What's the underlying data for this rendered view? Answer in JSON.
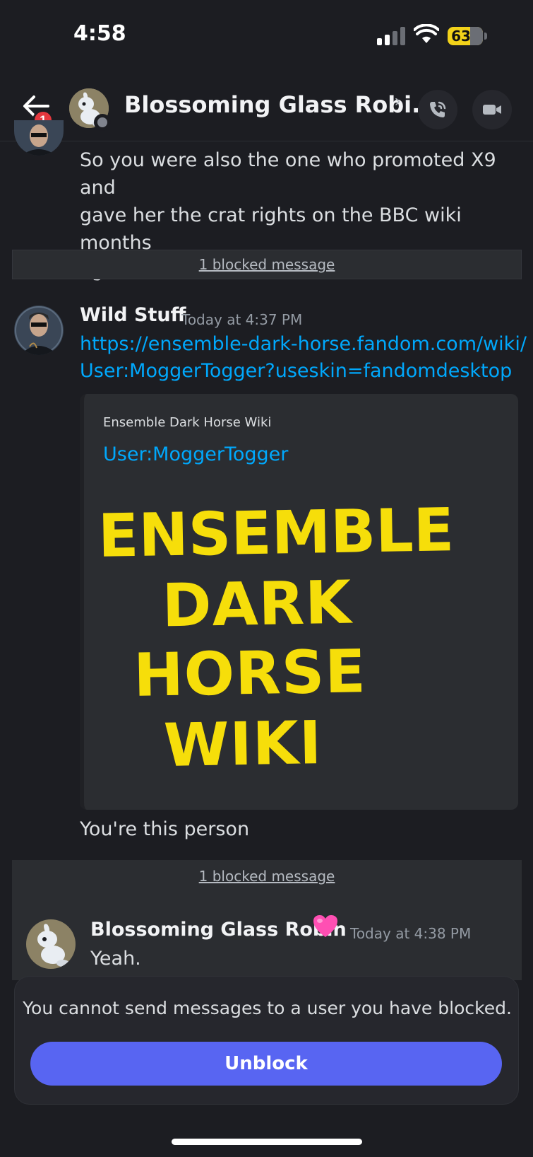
{
  "status_bar": {
    "time": "4:58",
    "battery": "63"
  },
  "header": {
    "unread_badge": "1",
    "title": "Blossoming Glass Robi...",
    "chevron": "›",
    "icons": {
      "back": "back-arrow-icon",
      "call": "phone-call-icon",
      "video": "video-camera-icon"
    }
  },
  "messages": {
    "first": {
      "text_line1": "So you were also the one who promoted X9 and",
      "text_line2": "gave her the crat rights on the BBC wiki months",
      "text_line3": "ago"
    },
    "blocked_1": "1 blocked message",
    "wild": {
      "author": "Wild Stuff",
      "timestamp": "Today at 4:37 PM",
      "link_line1": "https://ensemble-dark-horse.fandom.com/wiki/",
      "link_line2": "User:MoggerTogger?useskin=fandomdesktop",
      "embed": {
        "provider": "Ensemble Dark Horse Wiki",
        "title": "User:MoggerTogger",
        "logo_lines": [
          "ENSEMBLE",
          "DARK",
          "HORSE",
          "WIKI"
        ]
      },
      "followup": "You're this person"
    },
    "blocked_2": "1 blocked message",
    "robin": {
      "author": "Blossoming Glass Robin",
      "timestamp": "Today at 4:38 PM",
      "text": "Yeah."
    }
  },
  "blocked_panel": {
    "notice": "You cannot send messages to a user you have blocked.",
    "button": "Unblock"
  },
  "colors": {
    "accent": "#5865f2",
    "link": "#00a8fc",
    "badge": "#e5383e",
    "logo_yellow": "#f6de0a"
  }
}
